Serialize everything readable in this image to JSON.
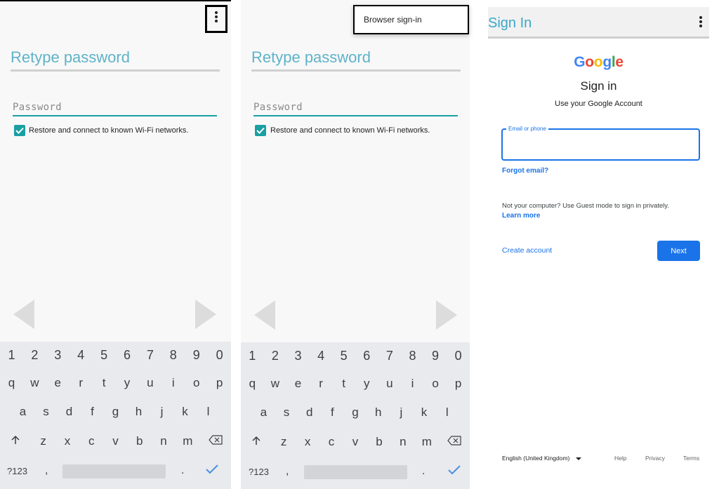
{
  "panel1": {
    "title": "Retype password",
    "password_placeholder": "Password",
    "checkbox_label": "Restore and connect to known Wi-Fi networks."
  },
  "panel2": {
    "title": "Retype password",
    "password_placeholder": "Password",
    "checkbox_label": "Restore and connect to known Wi-Fi networks.",
    "menu_item": "Browser sign-in"
  },
  "keyboard": {
    "row_numbers": [
      "1",
      "2",
      "3",
      "4",
      "5",
      "6",
      "7",
      "8",
      "9",
      "0"
    ],
    "row_top": [
      "q",
      "w",
      "e",
      "r",
      "t",
      "y",
      "u",
      "i",
      "o",
      "p"
    ],
    "row_home": [
      "a",
      "s",
      "d",
      "f",
      "g",
      "h",
      "j",
      "k",
      "l"
    ],
    "row_bottom": [
      "z",
      "x",
      "c",
      "v",
      "b",
      "n",
      "m"
    ],
    "symbols_key": "?123",
    "comma": ",",
    "period": "."
  },
  "signin": {
    "bar_title": "Sign In",
    "logo_letters": [
      "G",
      "o",
      "o",
      "g",
      "l",
      "e"
    ],
    "heading": "Sign in",
    "subheading": "Use your Google Account",
    "email_label": "Email or phone",
    "forgot_email": "Forgot email?",
    "guest_note": "Not your computer? Use Guest mode to sign in privately.",
    "learn_more": "Learn more",
    "create_account": "Create account",
    "next": "Next",
    "language": "English (United Kingdom)",
    "help": "Help",
    "privacy": "Privacy",
    "terms": "Terms"
  },
  "colors": {
    "title_teal": "#5fb3c9",
    "accent_teal": "#1aa0a4",
    "google_blue": "#1a73e8",
    "keyboard_bg": "#e8eaed"
  }
}
